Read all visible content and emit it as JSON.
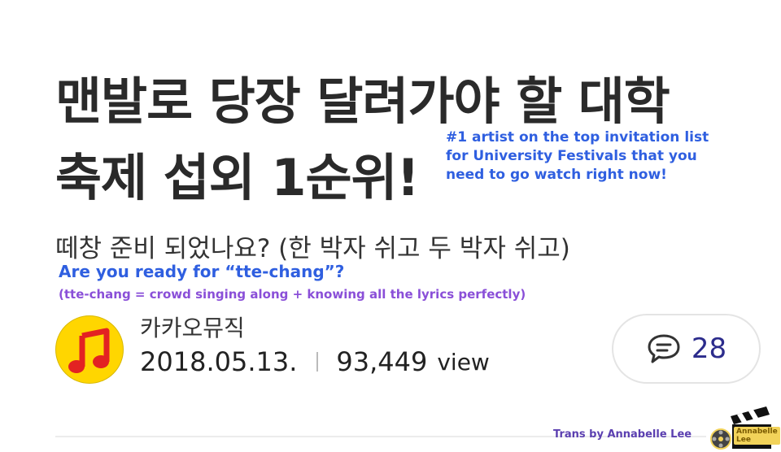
{
  "article": {
    "title_line1": "맨발로 당장 달려가야 할 대학",
    "title_line2": "축제 섭외 1순위!",
    "subtitle": "떼창 준비 되었나요? (한 박자 쉬고 두 박자 쉬고)",
    "source": "카카오뮤직",
    "date": "2018.05.13.",
    "views": "93,449",
    "view_label": "view",
    "comment_count": "28"
  },
  "translations": {
    "title_line1": "#1 artist on the top invitation list",
    "title_line2": "for University Festivals that you",
    "title_line3": "need to go watch right now!",
    "subtitle_line1": "Are you ready for “tte-chang”?",
    "subtitle_line2": "(tte-chang = crowd singing along + knowing all the lyrics perfectly)"
  },
  "credit": {
    "text": "Trans by Annabelle Lee",
    "logo_text_line1": "Annabelle",
    "logo_text_line2": "Lee"
  },
  "icons": {
    "app_icon": "music-note-icon",
    "comment_icon": "speech-bubble-icon",
    "logo_icon": "film-clapperboard-icon"
  },
  "colors": {
    "accent_blue": "#2f5fe0",
    "accent_purple": "#8a4fd8",
    "app_icon_yellow": "#ffd600",
    "app_icon_red": "#e32222",
    "comment_count_color": "#2c2c8c"
  }
}
